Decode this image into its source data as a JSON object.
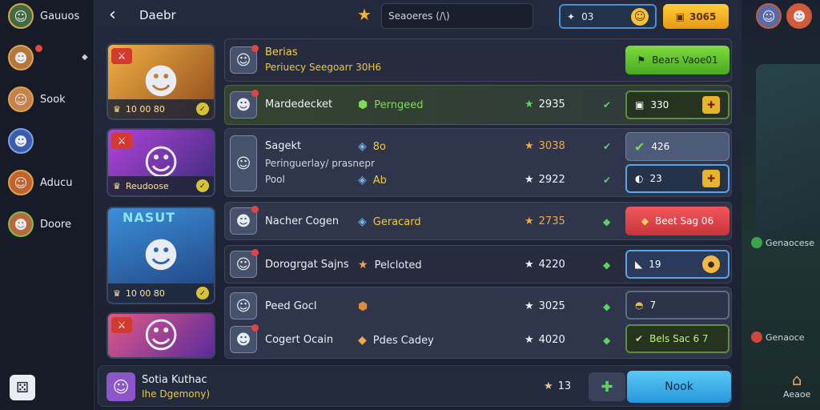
{
  "sidebar": {
    "items": [
      {
        "label": "Gauuos",
        "icon": "hero-avatar-icon"
      },
      {
        "label": "",
        "icon": "hero-avatar-icon"
      },
      {
        "label": "Sook",
        "icon": "hero-avatar-icon"
      },
      {
        "label": "",
        "icon": "hero-avatar-icon"
      },
      {
        "label": "Aducu",
        "icon": "hero-avatar-icon"
      },
      {
        "label": "Doore",
        "icon": "hero-avatar-icon"
      }
    ]
  },
  "header": {
    "title": "Daebr",
    "search_value": "Seaoeres (/\\)",
    "pill_a_value": "03",
    "pill_b_value": "3065"
  },
  "cards": [
    {
      "footer_value": "10 00 80"
    },
    {
      "footer_value": "Reudoose"
    },
    {
      "banner": "NASUT"
    },
    {
      "footer_value": ""
    }
  ],
  "top_row": {
    "name": "Berias",
    "sub": "Periuecy Seegoarr 30H6",
    "action": "Bears Vaoe01"
  },
  "rows": [
    {
      "name": "Mardedecket",
      "status": "Perngeed",
      "score": "2935",
      "action": "330"
    },
    {
      "name": "Sagekt",
      "sub": "Peringuerlay/ prasnepr",
      "extra": "Pool",
      "status": "8o",
      "score": "3038",
      "action": "426"
    },
    {
      "status": "Ab",
      "score": "2922",
      "action": "23"
    },
    {
      "name": "Nacher Cogen",
      "status": "Geracard",
      "score": "2735",
      "action": "Beet Sag 06"
    },
    {
      "name": "Dorogrgat Sajns",
      "status": "Pelcloted",
      "score": "4220",
      "action": "19"
    },
    {
      "name": "Peed Gocl",
      "status": "",
      "score": "3025",
      "action": "7"
    },
    {
      "name": "Cogert Ocain",
      "status": "Pdes Cadey",
      "score": "4020",
      "action": "Bels Sac 6 7"
    }
  ],
  "footer": {
    "name": "Sotia Kuthac",
    "sub": "Ihe Dgemony)",
    "count": "13",
    "button": "Nook"
  },
  "rail": {
    "items": [
      "Genaocese",
      "Genaoce"
    ],
    "home": "Aeaoe"
  },
  "colors": {
    "accent_gold": "#f0c83d",
    "accent_green": "#5bd465",
    "accent_blue": "#2896d9",
    "accent_red": "#d23a2e"
  }
}
